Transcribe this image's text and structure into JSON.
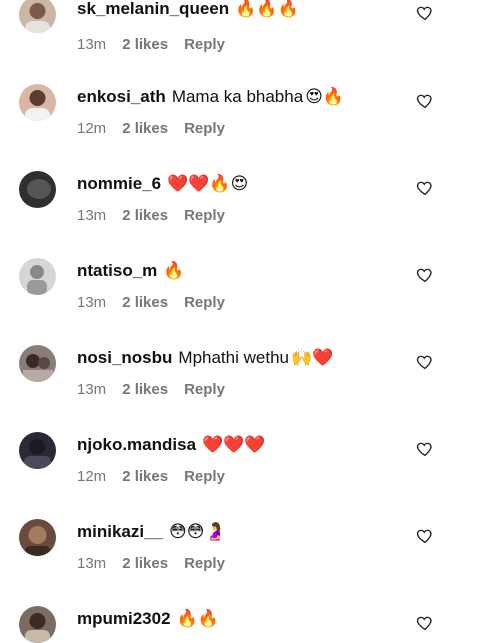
{
  "comments": [
    {
      "username": "sk_melanin_queen",
      "text": "",
      "emoji": "🔥🔥🔥",
      "time": "13m",
      "likes": "2 likes",
      "reply": "Reply",
      "avatar_color": "#cbb7a6"
    },
    {
      "username": "enkosi_ath",
      "text": "Mama ka bhabha",
      "emoji": "😍🔥",
      "time": "12m",
      "likes": "2 likes",
      "reply": "Reply",
      "avatar_color": "#d8b8a4"
    },
    {
      "username": "nommie_6",
      "text": "",
      "emoji": "❤️❤️🔥😍",
      "time": "13m",
      "likes": "2 likes",
      "reply": "Reply",
      "avatar_color": "#2f2f2f"
    },
    {
      "username": "ntatiso_m",
      "text": "",
      "emoji": "🔥",
      "time": "13m",
      "likes": "2 likes",
      "reply": "Reply",
      "avatar_color": "#bdbdbd"
    },
    {
      "username": "nosi_nosbu",
      "text": "Mphathi wethu",
      "emoji": "🙌❤️",
      "time": "13m",
      "likes": "2 likes",
      "reply": "Reply",
      "avatar_color": "#8a7c78"
    },
    {
      "username": "njoko.mandisa",
      "text": "",
      "emoji": "❤️❤️❤️",
      "time": "12m",
      "likes": "2 likes",
      "reply": "Reply",
      "avatar_color": "#2a2a34"
    },
    {
      "username": "minikazi__",
      "text": "",
      "emoji": "😳😳🤰",
      "time": "13m",
      "likes": "2 likes",
      "reply": "Reply",
      "avatar_color": "#6a4a3a"
    },
    {
      "username": "mpumi2302",
      "text": "",
      "emoji": "🔥🔥",
      "time": "",
      "likes": "",
      "reply": "",
      "avatar_color": "#7c6c60"
    }
  ]
}
